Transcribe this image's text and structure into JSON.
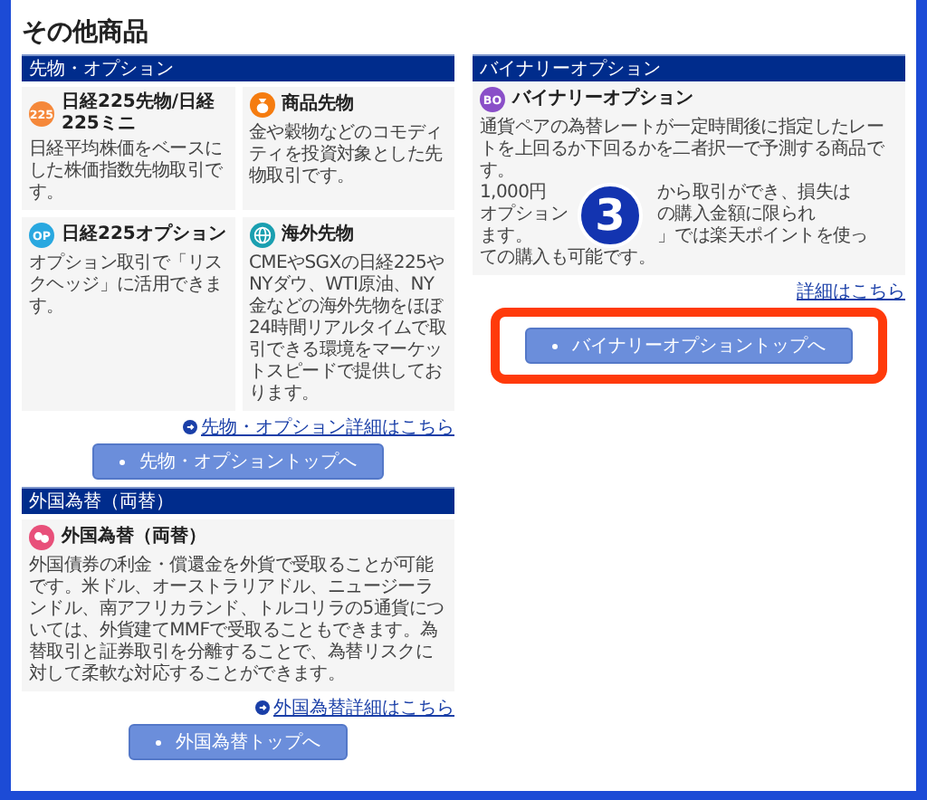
{
  "title": "その他商品",
  "left": {
    "sections": [
      {
        "header": "先物・オプション",
        "cards": [
          {
            "title": "日経225先物/日経225ミニ",
            "icon_text": "225",
            "color": "#f5883a",
            "text": "日経平均株価をベースにした株価指数先物取引です。"
          },
          {
            "title": "商品先物",
            "color": "#f57c10",
            "text": "金や穀物などのコモディティを投資対象とした先物取引です。"
          },
          {
            "title": "日経225オプション",
            "icon_text": "OP",
            "color": "#29a8e0",
            "text": "オプション取引で「リスクヘッジ」に活用できます。"
          },
          {
            "title": "海外先物",
            "color": "#1a9fb0",
            "text": "CMEやSGXの日経225やNYダウ、WTI原油、NY金などの海外先物をほぼ24時間リアルタイムで取引できる環境をマーケットスピードで提供しております。"
          }
        ],
        "link": "先物・オプション詳細はこちら",
        "button": "先物・オプショントップへ"
      },
      {
        "header": "外国為替（両替）",
        "cards": [
          {
            "title": "外国為替（両替）",
            "color": "#e8507a",
            "text": "外国債券の利金・償還金を外貨で受取ることが可能です。米ドル、オーストラリアドル、ニュージーランドル、南アフリカランド、トルコリラの5通貨については、外貨建てMMFで受取ることもできます。為替取引と証券取引を分離することで、為替リスクに対して柔軟な対応することができます。"
          }
        ],
        "link": "外国為替詳細はこちら",
        "button": "外国為替トップへ"
      }
    ]
  },
  "right": {
    "header": "バイナリーオプション",
    "card": {
      "title": "バイナリーオプション",
      "icon_text": "BO",
      "color": "#8a4fc8",
      "lines": [
        [
          "通貨ペアの為替レートが一定時間後に指定したレー"
        ],
        [
          "トを上回るか下回るかを二者択一で予測する商品で"
        ],
        [
          "す。"
        ],
        [
          "1,000円",
          "から取引ができ、損失は"
        ],
        [
          "オプション",
          "の購入金額に限られ"
        ],
        [
          "ます。",
          "」では楽天ポイントを使っ"
        ],
        [
          "ての購入も可能です。"
        ]
      ]
    },
    "link": "詳細はこちら",
    "button": "バイナリーオプショントップへ",
    "badge": "3"
  }
}
